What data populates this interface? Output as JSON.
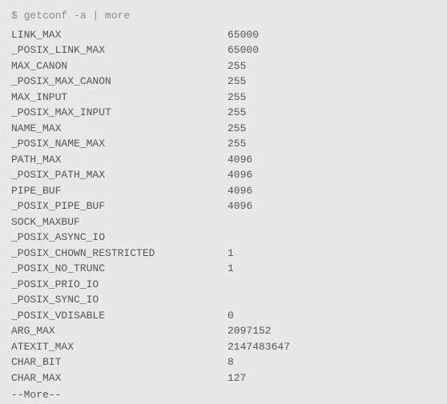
{
  "command": "$ getconf -a | more",
  "rows": [
    {
      "name": "LINK_MAX",
      "value": "65000"
    },
    {
      "name": "_POSIX_LINK_MAX",
      "value": "65000"
    },
    {
      "name": "MAX_CANON",
      "value": "255"
    },
    {
      "name": "_POSIX_MAX_CANON",
      "value": "255"
    },
    {
      "name": "MAX_INPUT",
      "value": "255"
    },
    {
      "name": "_POSIX_MAX_INPUT",
      "value": "255"
    },
    {
      "name": "NAME_MAX",
      "value": "255"
    },
    {
      "name": "_POSIX_NAME_MAX",
      "value": "255"
    },
    {
      "name": "PATH_MAX",
      "value": "4096"
    },
    {
      "name": "_POSIX_PATH_MAX",
      "value": "4096"
    },
    {
      "name": "PIPE_BUF",
      "value": "4096"
    },
    {
      "name": "_POSIX_PIPE_BUF",
      "value": "4096"
    },
    {
      "name": "SOCK_MAXBUF",
      "value": ""
    },
    {
      "name": "_POSIX_ASYNC_IO",
      "value": ""
    },
    {
      "name": "_POSIX_CHOWN_RESTRICTED",
      "value": "1"
    },
    {
      "name": "_POSIX_NO_TRUNC",
      "value": "1"
    },
    {
      "name": "_POSIX_PRIO_IO",
      "value": ""
    },
    {
      "name": "_POSIX_SYNC_IO",
      "value": ""
    },
    {
      "name": "_POSIX_VDISABLE",
      "value": "0"
    },
    {
      "name": "ARG_MAX",
      "value": "2097152"
    },
    {
      "name": "ATEXIT_MAX",
      "value": "2147483647"
    },
    {
      "name": "CHAR_BIT",
      "value": "8"
    },
    {
      "name": "CHAR_MAX",
      "value": "127"
    }
  ],
  "more_prompt": "--More--"
}
